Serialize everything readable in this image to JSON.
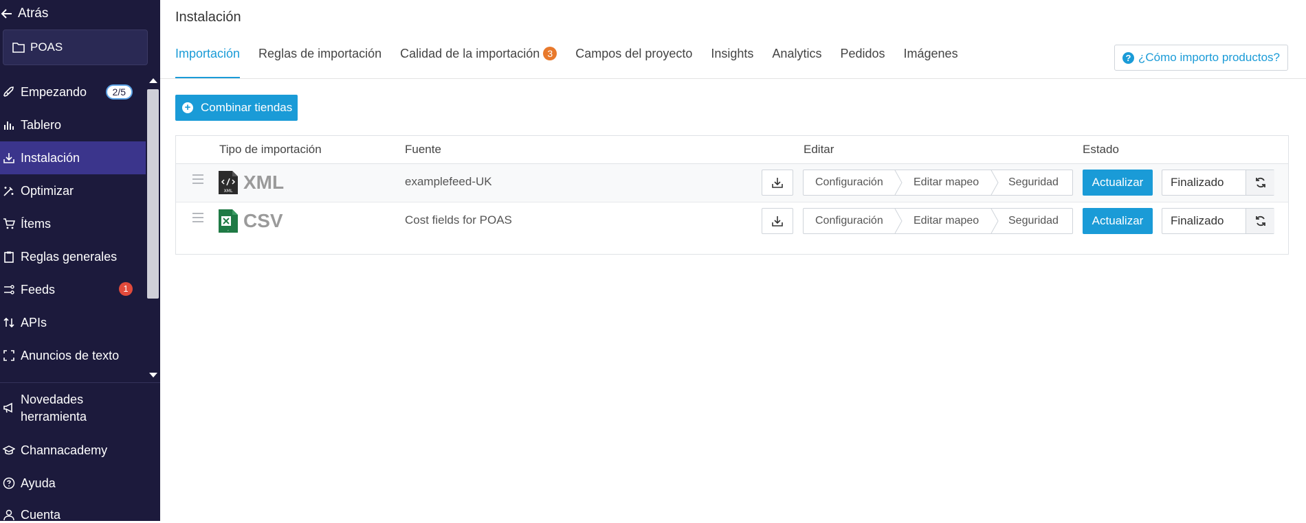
{
  "sidebar": {
    "back_label": "Atrás",
    "project_name": "POAS",
    "items": [
      {
        "label": "Empezando",
        "icon": "rocket-icon",
        "badge": "2/5"
      },
      {
        "label": "Tablero",
        "icon": "bar-chart-icon"
      },
      {
        "label": "Instalación",
        "icon": "install-icon",
        "active": true
      },
      {
        "label": "Optimizar",
        "icon": "magic-wand-icon"
      },
      {
        "label": "Ítems",
        "icon": "cart-icon"
      },
      {
        "label": "Reglas generales",
        "icon": "clipboard-icon"
      },
      {
        "label": "Feeds",
        "icon": "feeds-icon",
        "badge": "1"
      },
      {
        "label": "APIs",
        "icon": "arrows-icon"
      },
      {
        "label": "Anuncios de texto",
        "icon": "frame-icon"
      }
    ],
    "bottom": [
      {
        "label": "Novedades herramienta",
        "icon": "megaphone-icon"
      },
      {
        "label": "Channacademy",
        "icon": "graduation-cap-icon"
      },
      {
        "label": "Ayuda",
        "icon": "help-circle-icon"
      },
      {
        "label": "Cuenta",
        "icon": "user-icon"
      }
    ]
  },
  "header": {
    "title": "Instalación",
    "tabs": [
      {
        "label": "Importación",
        "active": true
      },
      {
        "label": "Reglas de importación"
      },
      {
        "label": "Calidad de la importación",
        "badge": "3"
      },
      {
        "label": "Campos del proyecto"
      },
      {
        "label": "Insights"
      },
      {
        "label": "Analytics"
      },
      {
        "label": "Pedidos"
      },
      {
        "label": "Imágenes"
      }
    ],
    "help_label": "¿Cómo importo productos?"
  },
  "main": {
    "combine_label": "Combinar tiendas",
    "columns": {
      "type": "Tipo de importación",
      "source": "Fuente",
      "edit": "Editar",
      "status": "Estado"
    },
    "rows": [
      {
        "type": "XML",
        "file_icon": "xml-file-icon",
        "source": "examplefeed-UK",
        "steps": [
          "Configuración",
          "Editar mapeo",
          "Seguridad"
        ],
        "update_label": "Actualizar",
        "status": "Finalizado"
      },
      {
        "type": "CSV",
        "file_icon": "csv-file-icon",
        "source": "Cost fields for POAS",
        "steps": [
          "Configuración",
          "Editar mapeo",
          "Seguridad"
        ],
        "update_label": "Actualizar",
        "status": "Finalizado"
      }
    ]
  },
  "colors": {
    "sidebar_bg": "#1c1a3c",
    "sidebar_active": "#3b358c",
    "accent": "#1a9bd7",
    "badge_orange": "#e8792c",
    "badge_red": "#e24a3b"
  }
}
